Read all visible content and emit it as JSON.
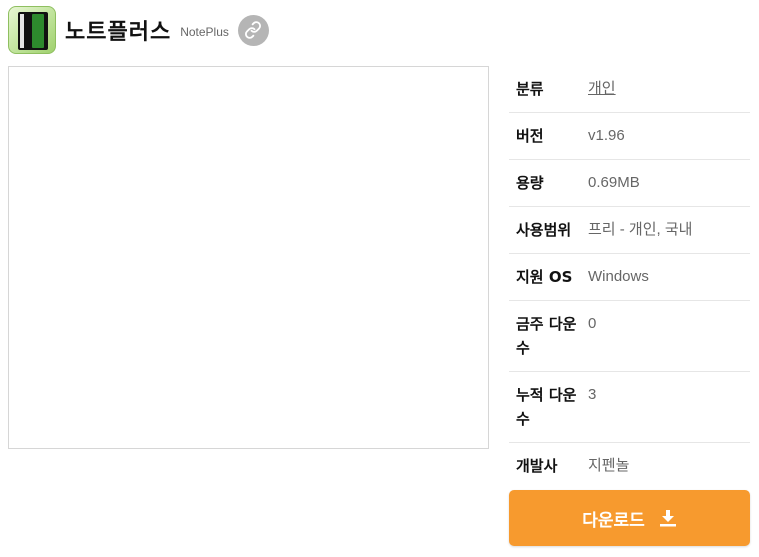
{
  "app": {
    "title": "노트플러스",
    "subtitle": "NotePlus",
    "icon": "notebook-app-icon",
    "link_icon": "link-icon"
  },
  "info": {
    "rows": [
      {
        "label": "분류",
        "value": "개인"
      },
      {
        "label": "버전",
        "value": "v1.96"
      },
      {
        "label": "용량",
        "value": "0.69MB"
      },
      {
        "label": "사용범위",
        "value": "프리 - 개인, 국내"
      },
      {
        "label": "지원 OS",
        "value": "Windows"
      },
      {
        "label": "금주 다운수",
        "value": "0"
      },
      {
        "label": "누적 다운수",
        "value": "3"
      },
      {
        "label": "개발사",
        "value": "지펜놀"
      }
    ]
  },
  "download": {
    "label": "다운로드",
    "icon": "download-icon",
    "color": "#f79a2e"
  }
}
